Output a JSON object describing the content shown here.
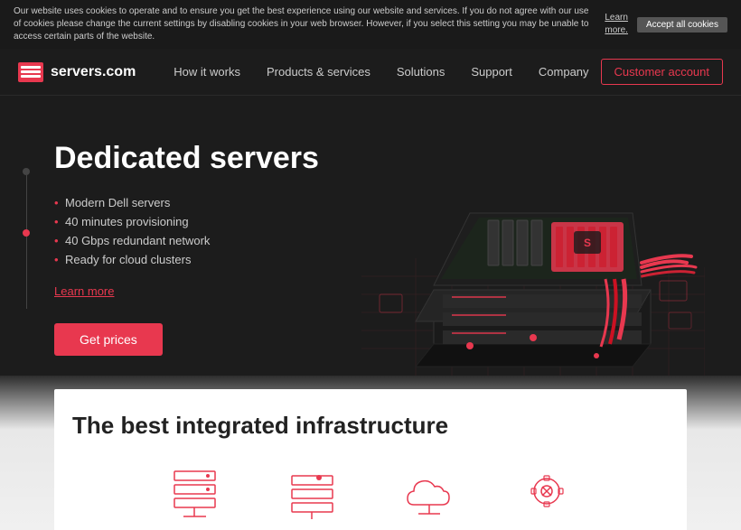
{
  "cookie": {
    "message": "Our website uses cookies to operate and to ensure you get the best experience using our website and services. If you do not agree with our use of cookies please change the current settings by disabling cookies in your web browser. However, if you select this setting you may be unable to access certain parts of the website.",
    "link_text": "Learn more.",
    "accept_label": "Accept all cookies"
  },
  "nav": {
    "logo_text": "servers.com",
    "links": [
      {
        "label": "How it works",
        "id": "how-it-works"
      },
      {
        "label": "Products & services",
        "id": "products-services"
      },
      {
        "label": "Solutions",
        "id": "solutions"
      },
      {
        "label": "Support",
        "id": "support"
      },
      {
        "label": "Company",
        "id": "company"
      }
    ],
    "cta_label": "Customer account"
  },
  "hero": {
    "title": "Dedicated servers",
    "bullets": [
      "Modern Dell servers",
      "40 minutes provisioning",
      "40 Gbps redundant network",
      "Ready for cloud clusters"
    ],
    "learn_more": "Learn more",
    "cta_label": "Get prices"
  },
  "infra": {
    "title": "The best integrated infrastructure"
  }
}
